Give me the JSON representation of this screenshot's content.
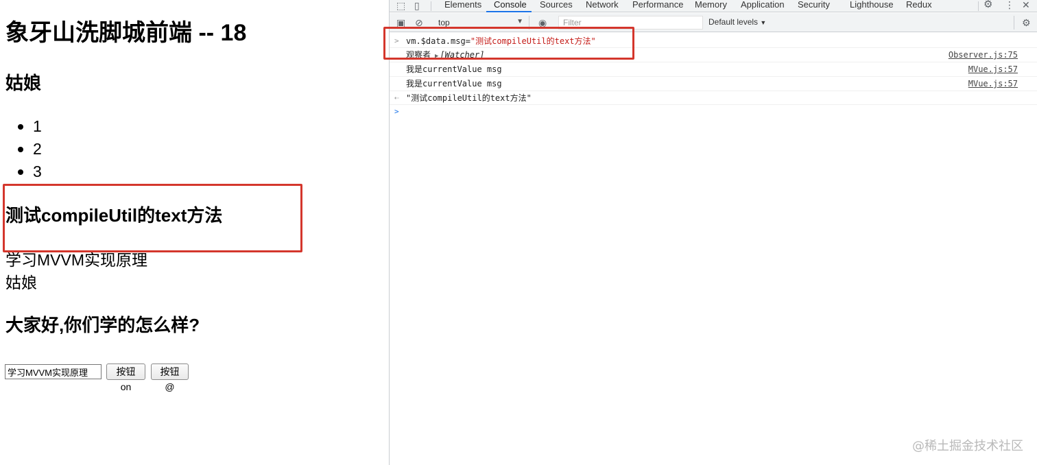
{
  "page": {
    "title": "象牙山洗脚城前端 -- 18",
    "subtitle": "姑娘",
    "list_items": [
      "1",
      "2",
      "3"
    ],
    "compile_heading": "测试compileUtil的text方法",
    "text_mvvm": "学习MVVM实现原理",
    "text_girl": "姑娘",
    "hello_heading": "大家好,你们学的怎么样?",
    "input_value": "学习MVVM实现原理",
    "button_on_label": "按钮on",
    "button_at_label": "按钮@"
  },
  "devtools": {
    "tabs": [
      "Elements",
      "Console",
      "Sources",
      "Network",
      "Performance",
      "Memory",
      "Application",
      "Security",
      "Lighthouse",
      "Redux"
    ],
    "active_tab": "Console",
    "context": "top",
    "filter_placeholder": "Filter",
    "levels_label": "Default levels",
    "console_rows": [
      {
        "kind": "input",
        "prefix": "vm.$data.msg=",
        "string": "\"测试compileUtil的text方法\""
      },
      {
        "kind": "log",
        "text": "观察者",
        "object": "[Watcher]",
        "source": "Observer.js:75"
      },
      {
        "kind": "log",
        "text": "我是currentValue msg",
        "source": "MVue.js:57"
      },
      {
        "kind": "log",
        "text": "我是currentValue msg",
        "source": "MVue.js:57"
      },
      {
        "kind": "result",
        "string": "\"测试compileUtil的text方法\""
      }
    ]
  },
  "highlight_color": "#d4362c",
  "watermark": "@稀土掘金技术社区"
}
